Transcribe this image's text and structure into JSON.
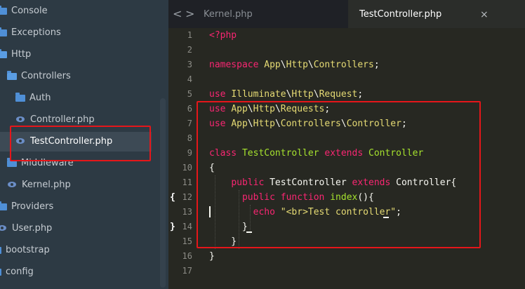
{
  "sidebar": {
    "items": [
      {
        "label": "Console",
        "icon": "folder-icon"
      },
      {
        "label": "Exceptions",
        "icon": "folder-icon"
      },
      {
        "label": "Http",
        "icon": "folder-icon"
      },
      {
        "label": "Controllers",
        "icon": "folder-open-icon"
      },
      {
        "label": "Auth",
        "icon": "folder-icon"
      },
      {
        "label": "Controller.php",
        "icon": "php-icon"
      },
      {
        "label": "TestController.php",
        "icon": "php-icon"
      },
      {
        "label": "Middleware",
        "icon": "folder-icon"
      },
      {
        "label": "Kernel.php",
        "icon": "php-icon"
      },
      {
        "label": "Providers",
        "icon": "folder-icon"
      },
      {
        "label": "User.php",
        "icon": "php-icon"
      },
      {
        "label": "bootstrap",
        "icon": "folder-icon"
      },
      {
        "label": "config",
        "icon": "folder-icon"
      }
    ]
  },
  "tabs": {
    "back": "<",
    "forward": ">",
    "inactive_label": "Kernel.php",
    "active_label": "TestController.php",
    "close": "×"
  },
  "editor": {
    "line_numbers": [
      "1",
      "2",
      "3",
      "4",
      "5",
      "6",
      "7",
      "8",
      "9",
      "10",
      "11",
      "12",
      "13",
      "14",
      "15",
      "16",
      "17"
    ],
    "fold_marks": {
      "open": "{",
      "close": "}"
    },
    "lines": [
      "<?php",
      "",
      "namespace App\\Http\\Controllers;",
      "",
      "use Illuminate\\Http\\Request;",
      "use App\\Http\\Requests;",
      "use App\\Http\\Controllers\\Controller;",
      "",
      "class TestController extends Controller",
      "{",
      "    public TestController extends Controller{",
      "      public function index(){",
      "        echo \"<br>Test controller\";",
      "      }",
      "    }",
      "}",
      ""
    ]
  },
  "colors": {
    "annotation": "#e5161a",
    "keyword": "#f92672",
    "string": "#e6db74",
    "class": "#a6e22e"
  }
}
